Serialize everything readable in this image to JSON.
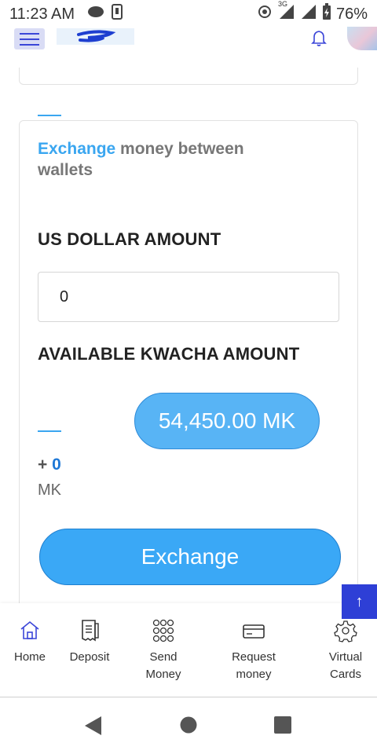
{
  "status_bar": {
    "time": "11:23 AM",
    "network": "3G",
    "battery": "76%"
  },
  "icons": {
    "menu": "hamburger-icon",
    "bell": "bell-icon",
    "home": "home-icon",
    "deposit": "receipt-icon",
    "send": "dots-grid-icon",
    "request": "card-icon",
    "virtual": "gear-icon"
  },
  "exchange_card": {
    "title_accent": "Exchange",
    "title_rest": " money between wallets",
    "usd_label": "US DOLLAR AMOUNT",
    "usd_value": "0",
    "kwacha_label": "AVAILABLE KWACHA AMOUNT",
    "kwacha_balance": "54,450.00 MK",
    "plus_sign": "+ ",
    "converted_value": "0",
    "converted_unit": "MK",
    "button_label": "Exchange"
  },
  "scroll_top_label": "↑",
  "bottom_nav": {
    "items": [
      {
        "label": "Home"
      },
      {
        "label": "Deposit"
      },
      {
        "label": "Send\nMoney"
      },
      {
        "label": "Request\nmoney"
      },
      {
        "label": "Virtual\nCards"
      }
    ]
  },
  "colors": {
    "accent": "#3aa6f0",
    "nav_blue": "#2e3fd6",
    "pill": "#58b4f5"
  }
}
